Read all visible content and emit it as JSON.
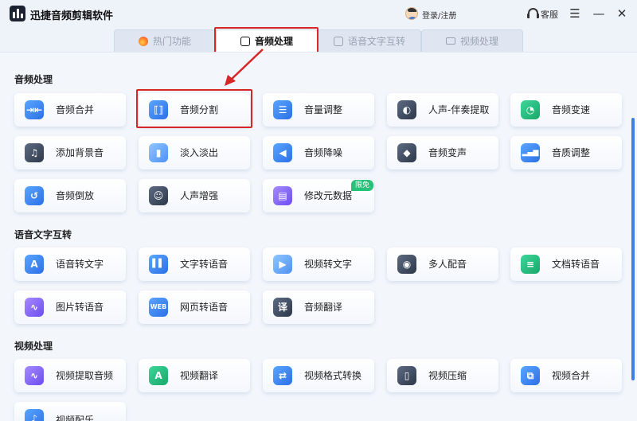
{
  "app": {
    "title": "迅捷音频剪辑软件",
    "login": "登录/注册",
    "service": "客服",
    "menu_glyph": "☰",
    "min_glyph": "—",
    "close_glyph": "✕"
  },
  "tabs": [
    {
      "label": "热门功能",
      "icon": "fire-icon"
    },
    {
      "label": "音频处理",
      "icon": "audio-file-icon",
      "active": true
    },
    {
      "label": "语音文字互转",
      "icon": "voice-text-icon"
    },
    {
      "label": "视频处理",
      "icon": "video-icon"
    }
  ],
  "sections": [
    {
      "title": "音频处理"
    },
    {
      "title": "语音文字互转"
    },
    {
      "title": "视频处理"
    }
  ],
  "cards": {
    "audio": [
      {
        "label": "音频合并",
        "glyph": "⇥⇤"
      },
      {
        "label": "音频分割",
        "glyph": "⟦⟧"
      },
      {
        "label": "音量调整",
        "glyph": "☰"
      },
      {
        "label": "人声-伴奏提取",
        "glyph": "◐"
      },
      {
        "label": "音频变速",
        "glyph": "◔"
      },
      {
        "label": "添加背景音",
        "glyph": "♫"
      },
      {
        "label": "淡入淡出",
        "glyph": "▮"
      },
      {
        "label": "音频降噪",
        "glyph": "◀"
      },
      {
        "label": "音频变声",
        "glyph": "◆"
      },
      {
        "label": "音质调整",
        "glyph": "▂▄▆"
      },
      {
        "label": "音频倒放",
        "glyph": "↺"
      },
      {
        "label": "人声增强",
        "glyph": "☺"
      },
      {
        "label": "修改元数据",
        "glyph": "▤"
      }
    ],
    "voice": [
      {
        "label": "语音转文字",
        "glyph": "A"
      },
      {
        "label": "文字转语音",
        "glyph": "▌▌"
      },
      {
        "label": "视频转文字",
        "glyph": "▶"
      },
      {
        "label": "多人配音",
        "glyph": "◉"
      },
      {
        "label": "文档转语音",
        "glyph": "≡"
      },
      {
        "label": "图片转语音",
        "glyph": "∿"
      },
      {
        "label": "网页转语音",
        "glyph": "WEB"
      },
      {
        "label": "音频翻译",
        "glyph": "译"
      }
    ],
    "video": [
      {
        "label": "视频提取音频",
        "glyph": "∿"
      },
      {
        "label": "视频翻译",
        "glyph": "A"
      },
      {
        "label": "视频格式转换",
        "glyph": "⇄"
      },
      {
        "label": "视频压缩",
        "glyph": "▯"
      },
      {
        "label": "视频合并",
        "glyph": "⧉"
      },
      {
        "label": "视频配乐",
        "glyph": "♪"
      }
    ]
  },
  "badge": "限免"
}
